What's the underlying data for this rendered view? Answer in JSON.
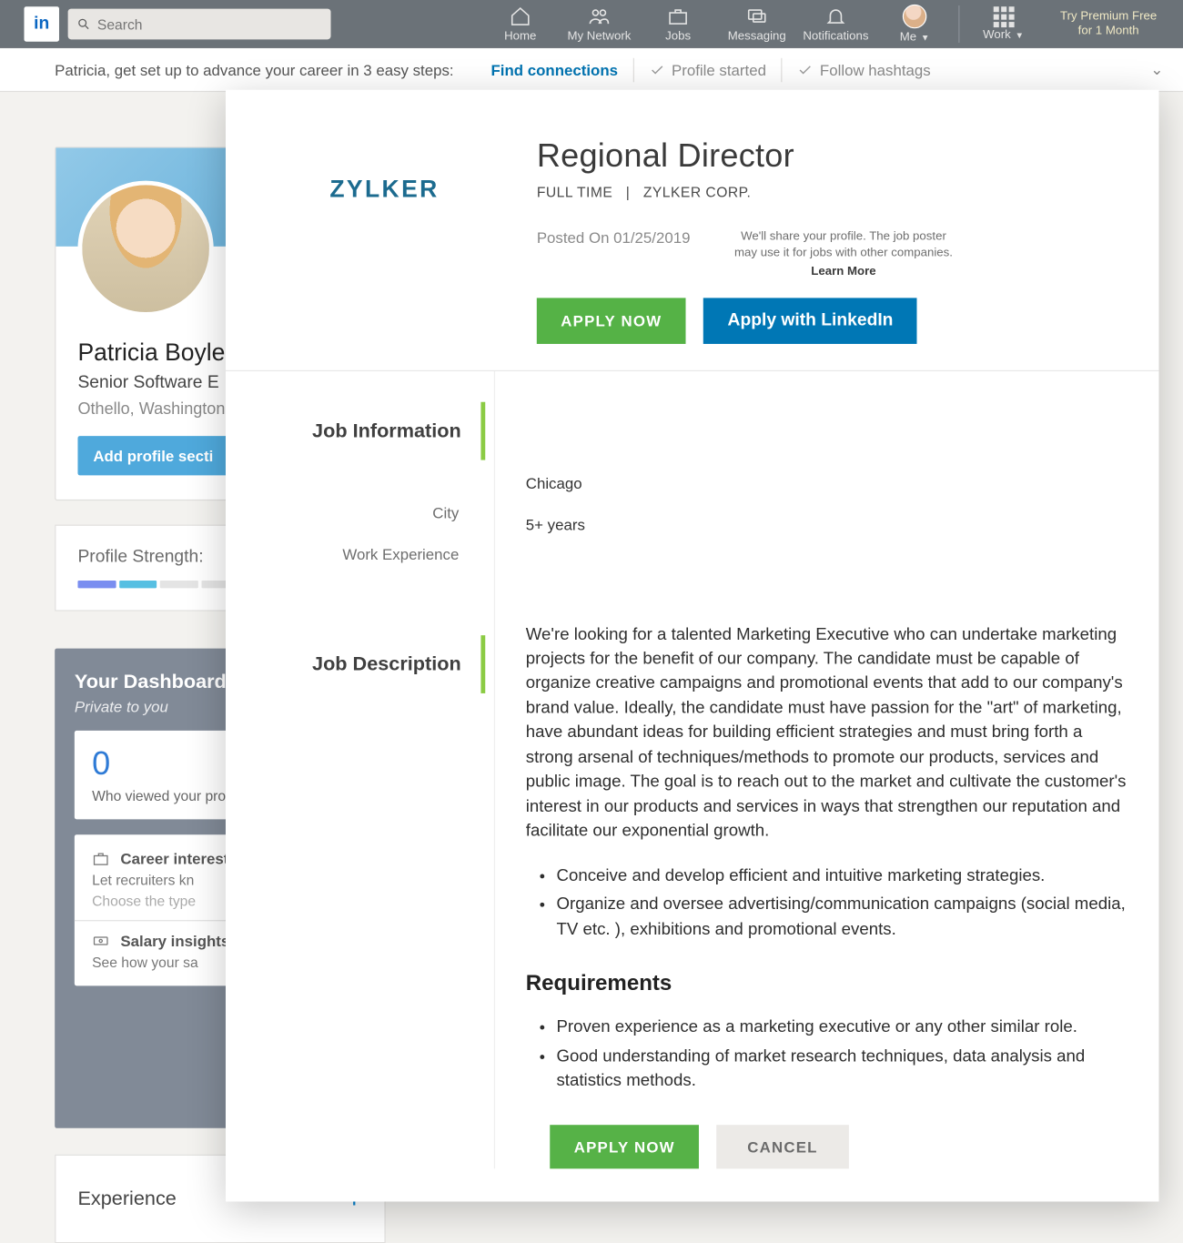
{
  "nav": {
    "search_placeholder": "Search",
    "items": {
      "home": "Home",
      "network": "My Network",
      "jobs": "Jobs",
      "messaging": "Messaging",
      "notifications": "Notifications",
      "me": "Me",
      "work": "Work"
    },
    "premium_line1": "Try Premium Free",
    "premium_line2": "for 1 Month"
  },
  "setup": {
    "intro": "Patricia, get set up to advance your career in 3 easy steps:",
    "steps": {
      "find": "Find connections",
      "profile": "Profile started",
      "hashtags": "Follow hashtags"
    }
  },
  "profile": {
    "name": "Patricia Boyle",
    "title": "Senior Software E",
    "location": "Othello, Washington",
    "add_section": "Add profile secti"
  },
  "strength": {
    "label": "Profile Strength:"
  },
  "dashboard": {
    "title": "Your Dashboard",
    "subtitle": "Private to you",
    "viewed_count": "0",
    "viewed_label": "Who viewed your pro",
    "career_title": "Career interest",
    "career_line1": "Let recruiters kn",
    "career_line2": "Choose the type",
    "salary_title": "Salary insights",
    "salary_line1": "See how your sa"
  },
  "experience": {
    "title": "Experience"
  },
  "job": {
    "company_logo_text": "ZYLKER",
    "title": "Regional Director",
    "type": "FULL TIME",
    "sep": "|",
    "company": "ZYLKER CORP.",
    "posted": "Posted On 01/25/2019",
    "share_note1": "We'll share your profile. The job poster",
    "share_note2": "may use it for jobs with other companies.",
    "learn_more": "Learn More",
    "apply_now": "APPLY  NOW",
    "apply_linkedin": "Apply with LinkedIn",
    "sections": {
      "info": "Job Information",
      "desc": "Job Description"
    },
    "fields": {
      "city_label": "City",
      "city_value": "Chicago",
      "exp_label": "Work Experience",
      "exp_value": "5+ years"
    },
    "description_p": "We're looking for a talented Marketing Executive who can undertake marketing projects for the benefit of our company. The candidate must be capable of  organize creative campaigns and promotional events that add to our company's brand value. Ideally, the  candidate must have passion for the \"art\" of marketing, have abundant ideas for building efficient strategies and must bring forth a strong arsenal of techniques/methods to promote our products, services and public image.  The goal is to reach out to the market and cultivate the customer's interest in our products and services in ways that strengthen our reputation and facilitate our exponential growth.",
    "desc_bullets": [
      "Conceive and develop efficient and intuitive marketing strategies.",
      "Organize and oversee advertising/communication campaigns (social media, TV etc. ), exhibitions and promotional events."
    ],
    "requirements_heading": "Requirements",
    "req_bullets": [
      "Proven experience as a marketing executive or any other similar role.",
      "Good understanding of market research techniques, data analysis and statistics methods."
    ],
    "footer": {
      "apply": "APPLY  NOW",
      "cancel": "CANCEL"
    }
  }
}
